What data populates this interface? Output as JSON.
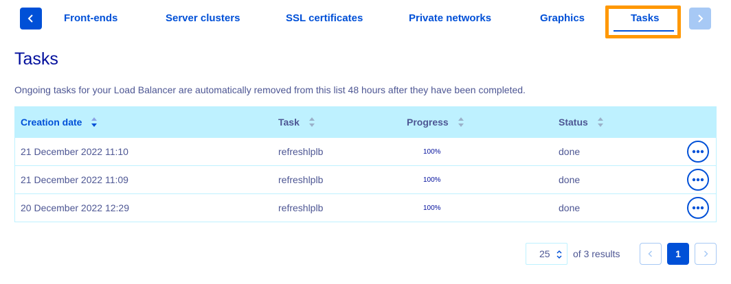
{
  "tabs": {
    "items": [
      {
        "label": "Front-ends"
      },
      {
        "label": "Server clusters"
      },
      {
        "label": "SSL certificates"
      },
      {
        "label": "Private networks"
      },
      {
        "label": "Graphics"
      },
      {
        "label": "Tasks",
        "active": true
      }
    ],
    "prev_icon": "chevron-left-icon",
    "next_icon": "chevron-right-icon"
  },
  "page": {
    "title": "Tasks",
    "description": "Ongoing tasks for your Load Balancer are automatically removed from this list 48 hours after they have been completed."
  },
  "table": {
    "columns": [
      {
        "label": "Creation date",
        "sorted": true
      },
      {
        "label": "Task"
      },
      {
        "label": "Progress"
      },
      {
        "label": "Status"
      }
    ],
    "rows": [
      {
        "creation_date": "21 December 2022 11:10",
        "task": "refreshlplb",
        "progress": "100%",
        "status": "done"
      },
      {
        "creation_date": "21 December 2022 11:09",
        "task": "refreshlplb",
        "progress": "100%",
        "status": "done"
      },
      {
        "creation_date": "20 December 2022 12:29",
        "task": "refreshlplb",
        "progress": "100%",
        "status": "done"
      }
    ],
    "row_action_icon": "ellipsis-icon"
  },
  "pagination": {
    "per_page": "25",
    "results_text": "of 3 results",
    "current_page": "1"
  },
  "colors": {
    "primary": "#0050d7",
    "header_bg": "#bef1ff",
    "highlight": "#ff9803",
    "title": "#000e9c",
    "text": "#4d5693"
  }
}
